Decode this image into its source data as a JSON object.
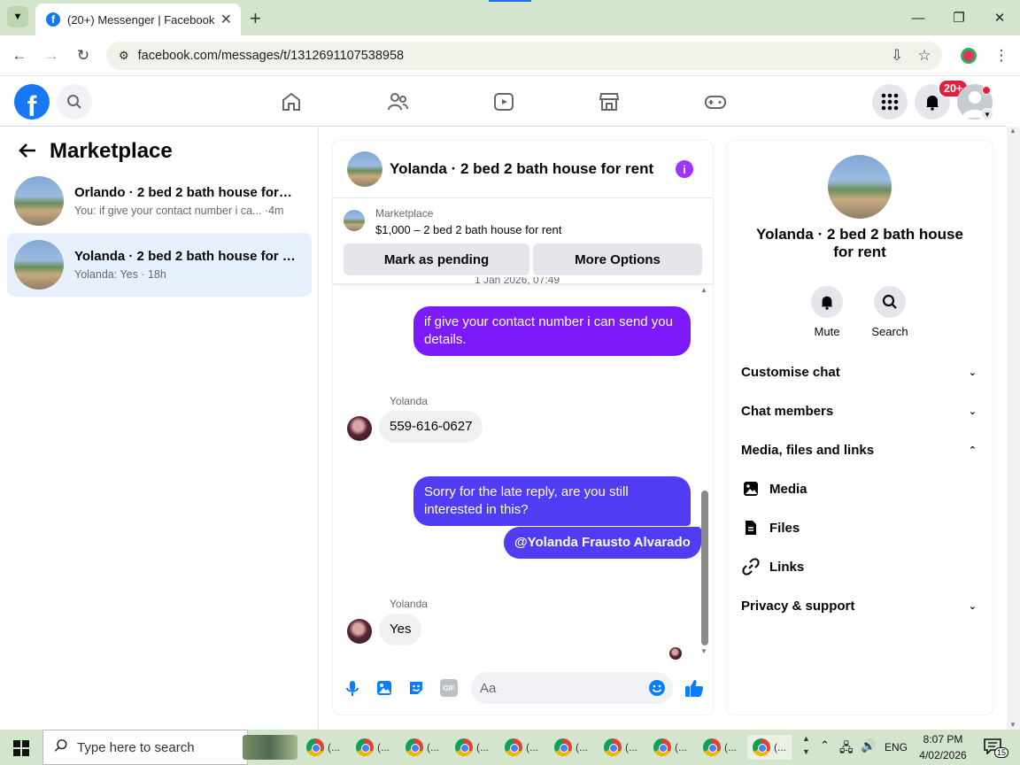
{
  "browser": {
    "tab_title": "(20+) Messenger | Facebook",
    "url": "facebook.com/messages/t/1312691107538958"
  },
  "header": {
    "notification_badge": "20+",
    "brand_color": "#1877f2"
  },
  "left_panel": {
    "title": "Marketplace",
    "conversations": [
      {
        "name": "Orlando · 2 bed 2 bath house for r...",
        "snippet": "You: if give your contact number i ca... ·4m",
        "active": false
      },
      {
        "name": "Yolanda · 2 bed 2 bath house for r...",
        "snippet": "Yolanda: Yes · 18h",
        "active": true
      }
    ]
  },
  "chat": {
    "title": "Yolanda · 2 bed 2 bath house for rent",
    "listing": {
      "label": "Marketplace",
      "description": "$1,000 – 2 bed 2 bath house for rent",
      "mark_pending": "Mark as pending",
      "more_options": "More Options"
    },
    "timestamp_partial": "1 Jan 2026, 07:49",
    "messages": [
      {
        "from": "me",
        "text": "if give your contact number  i can send you details."
      },
      {
        "from": "Yolanda",
        "sender_label": "Yolanda",
        "text": "559-616-0627"
      },
      {
        "from": "me",
        "text": "Sorry for the late reply, are you still interested in this?"
      },
      {
        "from": "me",
        "text": "@Yolanda Frausto Alvarado"
      },
      {
        "from": "Yolanda",
        "sender_label": "Yolanda",
        "text": "Yes"
      }
    ],
    "composer_placeholder": "Aa",
    "accent_purple": "#7b1bf9",
    "accent_indigo": "#4f3cf3"
  },
  "right_panel": {
    "name": "Yolanda · 2 bed 2 bath house for rent",
    "actions": [
      "Mute",
      "Search"
    ],
    "sections": [
      "Customise chat",
      "Chat members",
      "Media, files and links",
      "Privacy & support"
    ],
    "media_items": [
      "Media",
      "Files",
      "Links"
    ]
  },
  "taskbar": {
    "search_placeholder": "Type here to search",
    "app_label": "(...",
    "language": "ENG",
    "time": "8:07 PM",
    "date": "4/02/2026",
    "notif_count": "15"
  }
}
